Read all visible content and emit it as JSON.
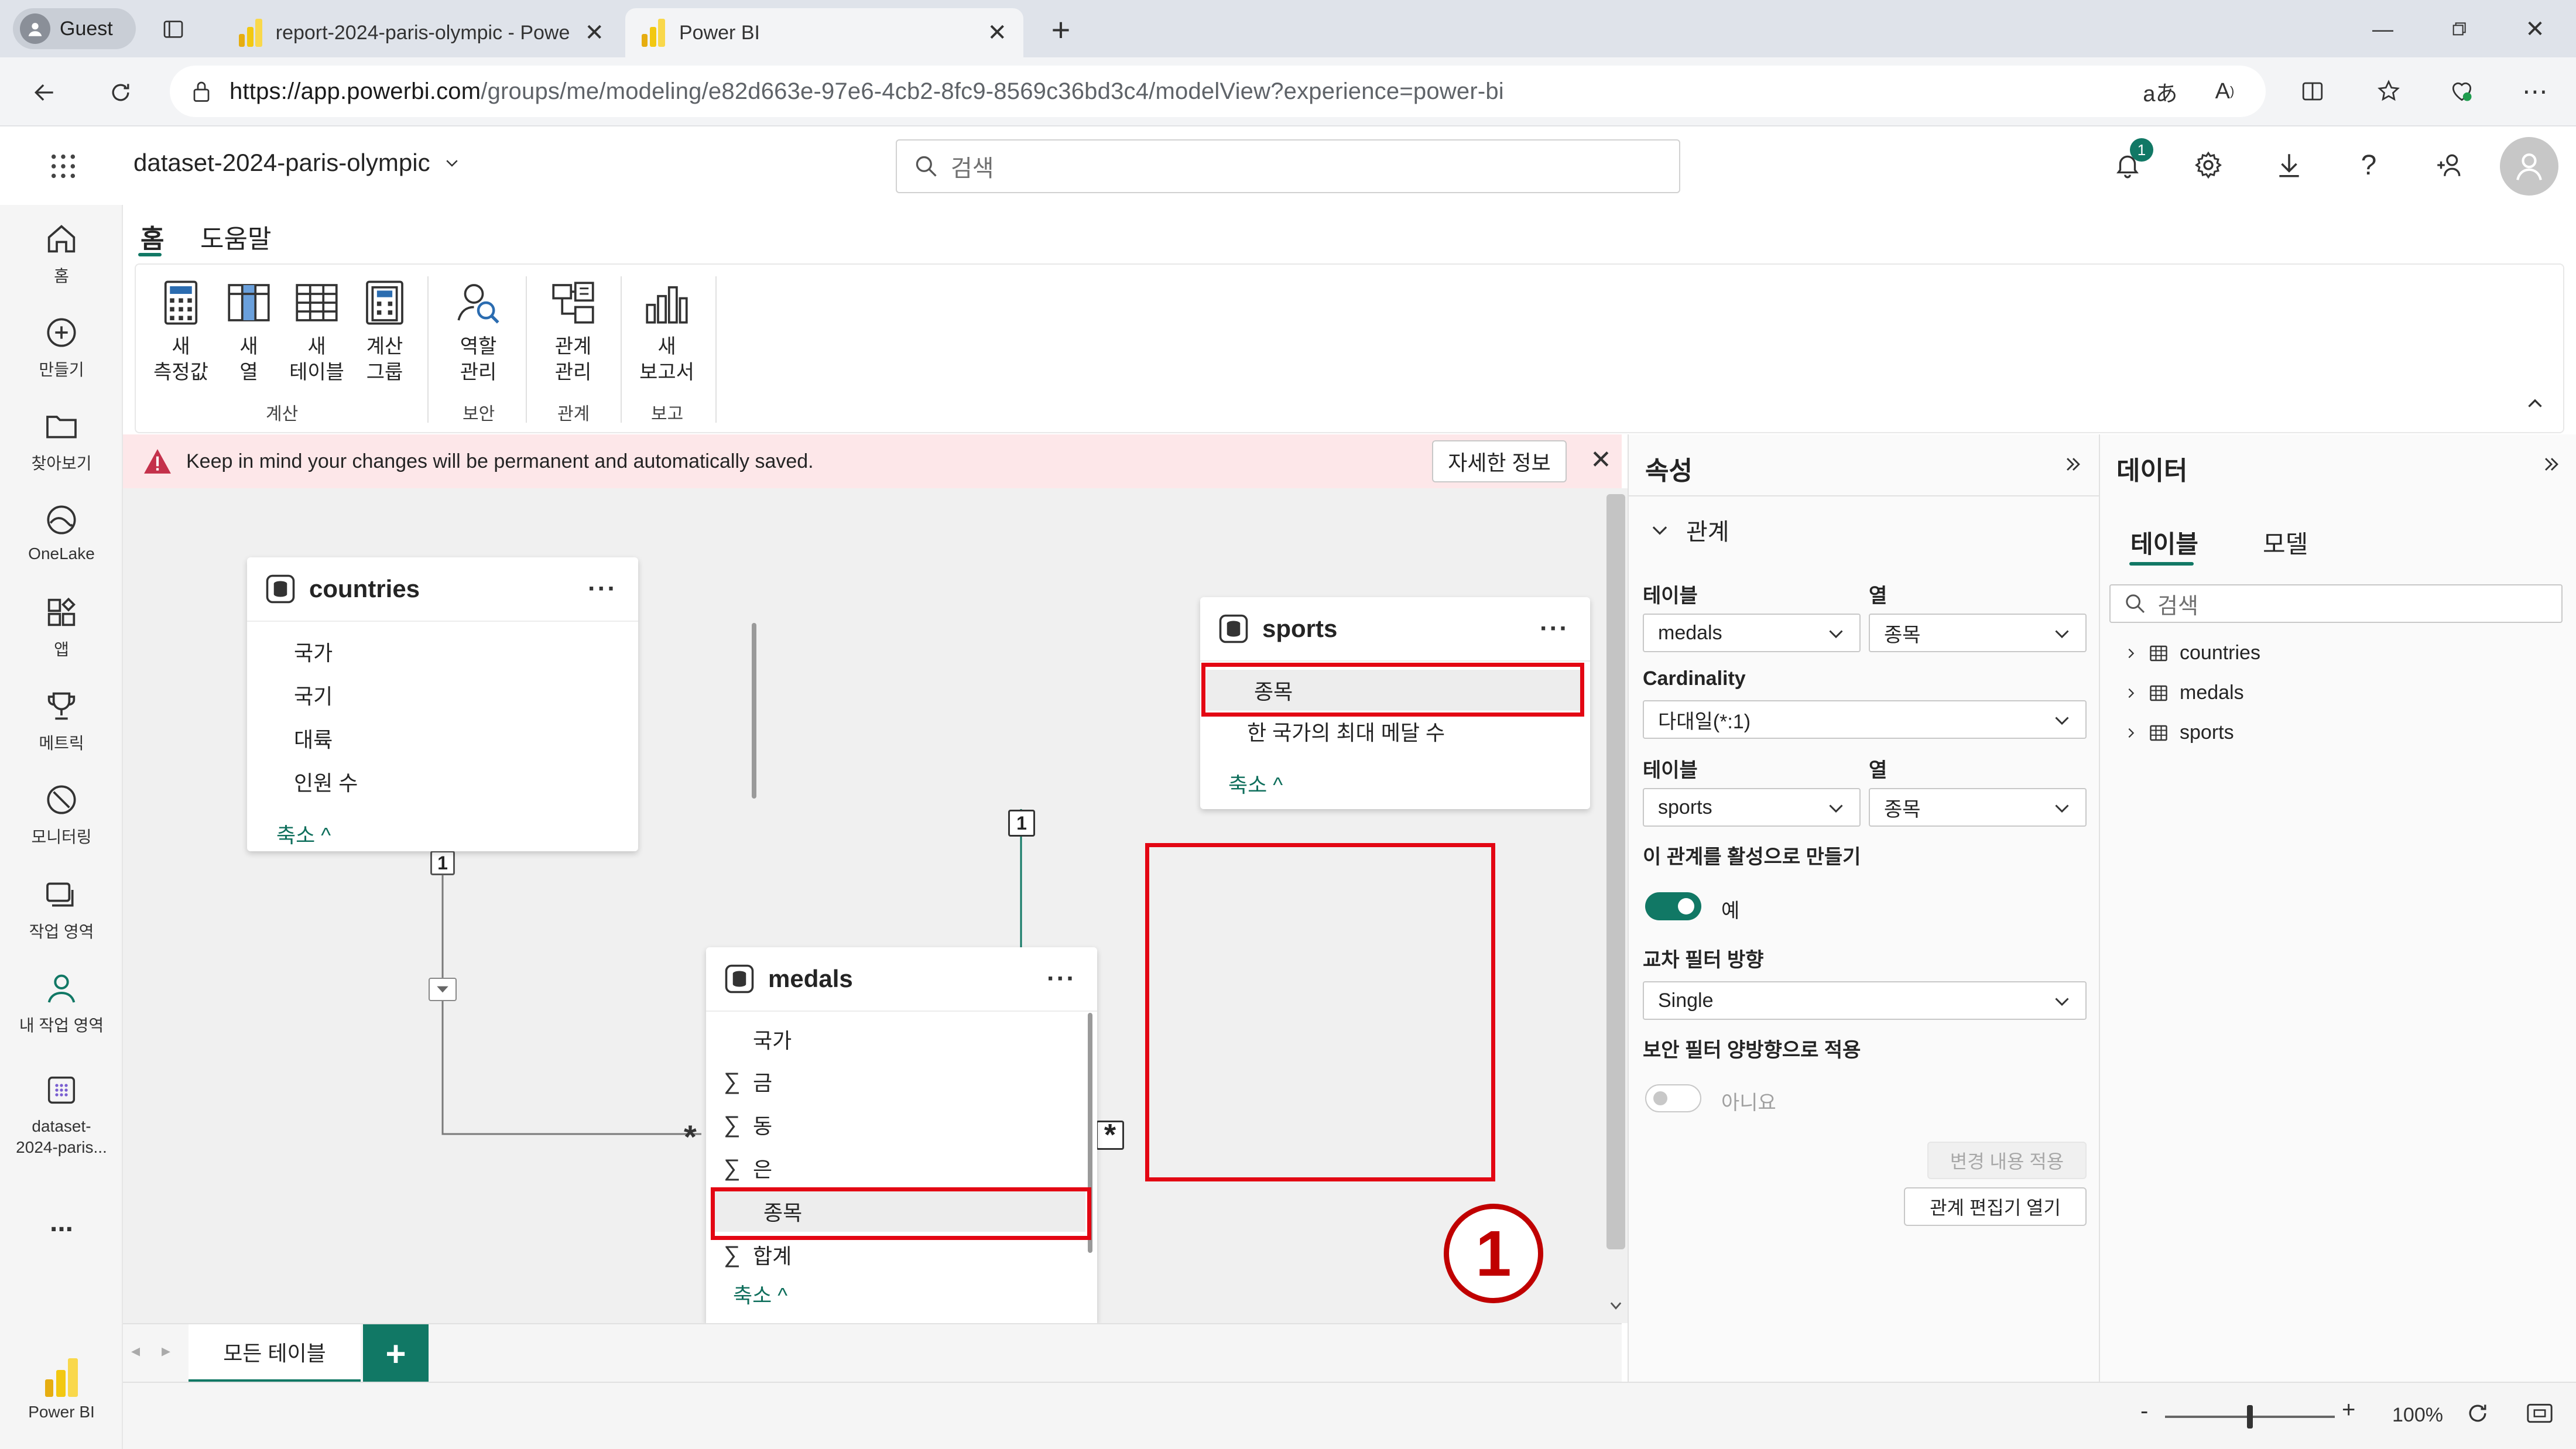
{
  "browser": {
    "profile": "Guest",
    "tabs": [
      {
        "title": "report-2024-paris-olympic - Powe"
      },
      {
        "title": "Power BI"
      }
    ],
    "url_domain": "https://app.powerbi.com",
    "url_path": "/groups/me/modeling/e82d663e-97e6-4cb2-8fc9-8569c36bd3c4/modelView?experience=power-bi"
  },
  "header": {
    "dataset_name": "dataset-2024-paris-olympic",
    "search_placeholder": "검색",
    "notification_count": "1"
  },
  "leftnav": {
    "items": [
      {
        "label": "홈"
      },
      {
        "label": "만들기"
      },
      {
        "label": "찾아보기"
      },
      {
        "label": "OneLake"
      },
      {
        "label": "앱"
      },
      {
        "label": "메트릭"
      },
      {
        "label": "모니터링"
      },
      {
        "label": "작업 영역"
      },
      {
        "label": "내 작업 영역"
      },
      {
        "label_line1": "dataset-",
        "label_line2": "2024-paris..."
      },
      {
        "label": "..."
      }
    ],
    "brand": "Power BI"
  },
  "ribbon": {
    "tabs": [
      "홈",
      "도움말"
    ],
    "buttons": [
      {
        "l1": "새",
        "l2": "측정값"
      },
      {
        "l1": "새",
        "l2": "열"
      },
      {
        "l1": "새",
        "l2": "테이블"
      },
      {
        "l1": "계산",
        "l2": "그룹"
      },
      {
        "l1": "역할",
        "l2": "관리"
      },
      {
        "l1": "관계",
        "l2": "관리"
      },
      {
        "l1": "새",
        "l2": "보고서"
      }
    ],
    "groups": [
      "계산",
      "보안",
      "관계",
      "보고"
    ]
  },
  "warning": {
    "message": "Keep in mind your changes will be permanent and automatically saved.",
    "details_button": "자세한 정보"
  },
  "model": {
    "countries": {
      "name": "countries",
      "columns": [
        "국가",
        "국기",
        "대륙",
        "인원 수"
      ],
      "collapse": "축소"
    },
    "sports": {
      "name": "sports",
      "columns": [
        "종목",
        "한 국가의 최대 메달 수"
      ],
      "collapse": "축소"
    },
    "medals": {
      "name": "medals",
      "columns": [
        {
          "sigma": "",
          "name": "국가"
        },
        {
          "sigma": "∑",
          "name": "금"
        },
        {
          "sigma": "∑",
          "name": "동"
        },
        {
          "sigma": "∑",
          "name": "은"
        },
        {
          "sigma": "",
          "name": "종목"
        },
        {
          "sigma": "∑",
          "name": "합계"
        }
      ],
      "collapse": "축소"
    },
    "relationship_labels": {
      "one": "1",
      "many": "*"
    },
    "annotation_number": "1"
  },
  "bottom": {
    "all_tables_tab": "모든 테이블",
    "add_label": "+",
    "zoom": "100%"
  },
  "properties": {
    "title": "속성",
    "section": "관계",
    "table_label": "테이블",
    "column_label": "열",
    "table1": "medals",
    "column1": "종목",
    "cardinality_label": "Cardinality",
    "cardinality_value": "다대일(*:1)",
    "table2": "sports",
    "column2": "종목",
    "active_label": "이 관계를 활성으로 만들기",
    "active_value": "예",
    "crossfilter_label": "교차 필터 방향",
    "crossfilter_value": "Single",
    "security_label": "보안 필터 양방향으로 적용",
    "security_value": "아니요",
    "apply_button": "변경 내용 적용",
    "editor_button": "관계 편집기 열기"
  },
  "datapane": {
    "title": "데이터",
    "tabs": [
      "테이블",
      "모델"
    ],
    "search_placeholder": "검색",
    "tables": [
      "countries",
      "medals",
      "sports"
    ]
  },
  "colors": {
    "accent": "#117865",
    "highlight": "#e30613",
    "warning_bg": "#fde7e9"
  }
}
